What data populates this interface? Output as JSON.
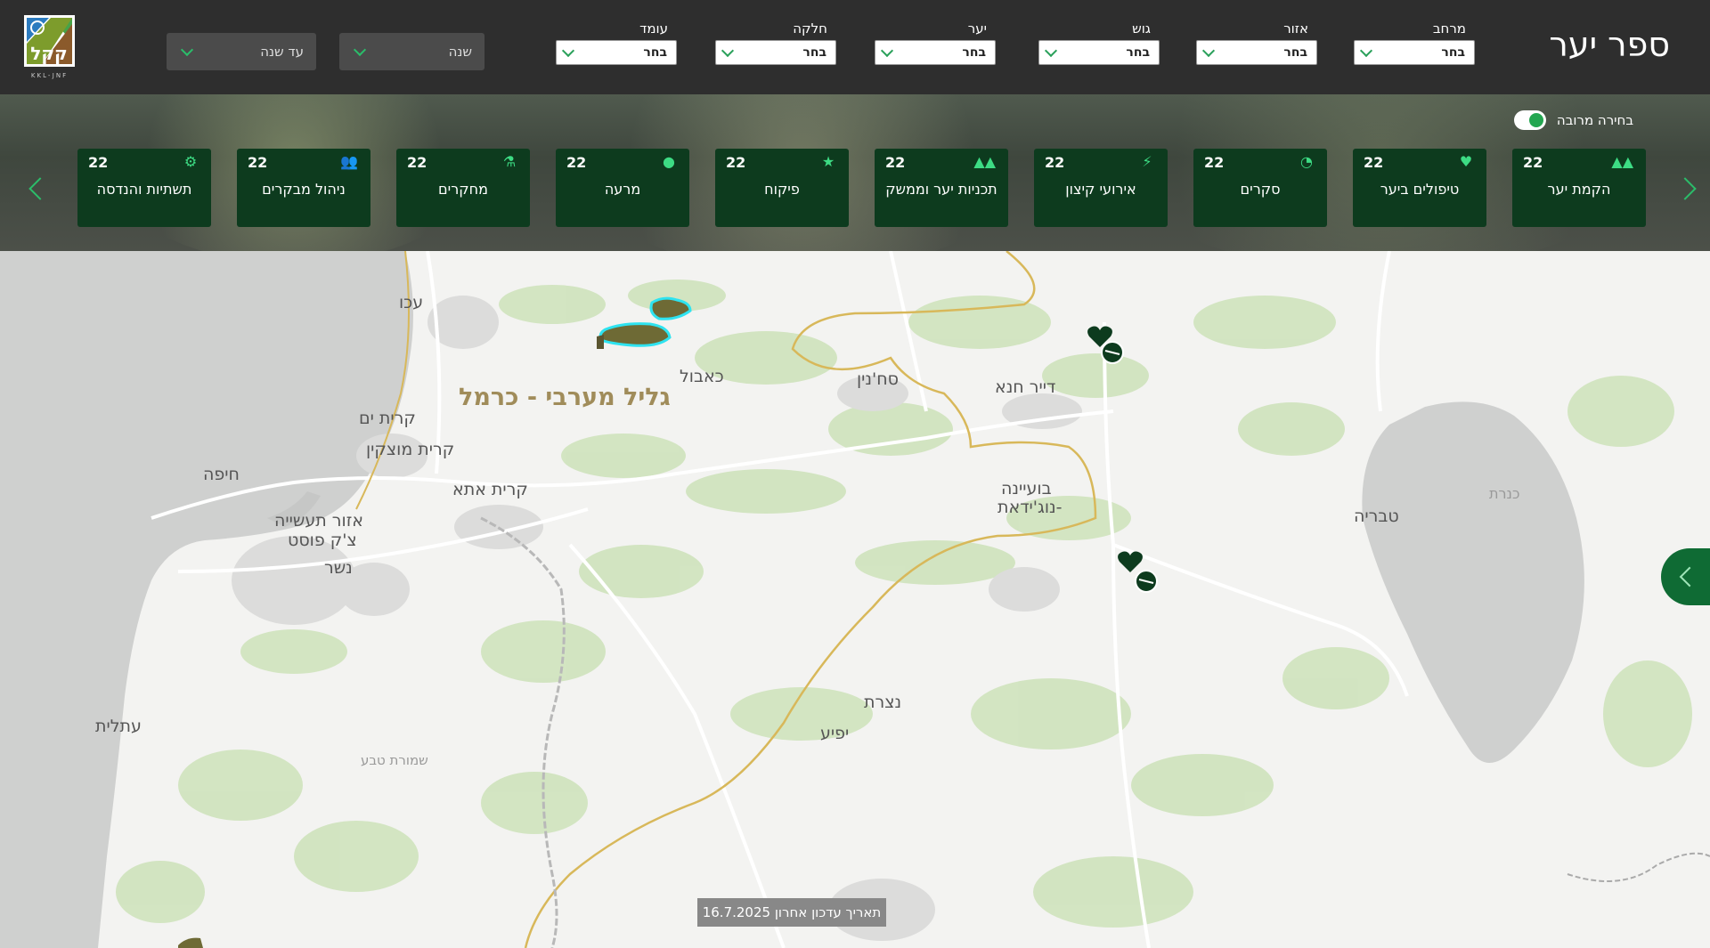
{
  "header": {
    "title": "ספר יער",
    "filters": [
      {
        "label": "מרחב",
        "value": "בחר"
      },
      {
        "label": "אזור",
        "value": "בחר"
      },
      {
        "label": "גוש",
        "value": "בחר"
      },
      {
        "label": "יער",
        "value": "בחר"
      },
      {
        "label": "חלקה",
        "value": "בחר"
      },
      {
        "label": "עומד",
        "value": "בחר"
      }
    ],
    "year_from_placeholder": "שנה",
    "year_to_placeholder": "עד שנה",
    "logo_text": "KKL-JNF",
    "logo_subtext": "קרן קיימת לישראל"
  },
  "band": {
    "multi_select_label": "בחירה מרובה",
    "multi_select_on": true,
    "cards": [
      {
        "label": "הקמת יער",
        "count": "22",
        "icon": "trees-icon"
      },
      {
        "label": "טיפולים ביער",
        "count": "22",
        "icon": "heart-icon"
      },
      {
        "label": "סקרים",
        "count": "22",
        "icon": "survey-icon"
      },
      {
        "label": "אירועי קיצון",
        "count": "22",
        "icon": "lightning-icon"
      },
      {
        "label": "תכניות יער וממשק",
        "count": "22",
        "icon": "trees-icon"
      },
      {
        "label": "פיקוח",
        "count": "22",
        "icon": "star-icon"
      },
      {
        "label": "מרעה",
        "count": "22",
        "icon": "cow-icon"
      },
      {
        "label": "מחקרים",
        "count": "22",
        "icon": "microscope-icon"
      },
      {
        "label": "ניהול מבקרים",
        "count": "22",
        "icon": "people-icon"
      },
      {
        "label": "תשתיות והנדסה",
        "count": "22",
        "icon": "engineering-icon"
      }
    ]
  },
  "map": {
    "region_label": "גליל מערבי - כרמל",
    "places": [
      "עכו",
      "כאבול",
      "סח'נין",
      "דייר חנא",
      "קרית ים",
      "קרית מוצקין",
      "חיפה",
      "קרית אתא",
      "אזור תעשייה",
      "צ'ק פוסט",
      "נשר",
      "בועיינה",
      "-נוג'ידאת",
      "טבריה",
      "כנרת",
      "נצרת",
      "יפיע",
      "עתלית",
      "שמורת טבע"
    ],
    "last_update": "תאריך עדכון אחרון 16.7.2025"
  }
}
